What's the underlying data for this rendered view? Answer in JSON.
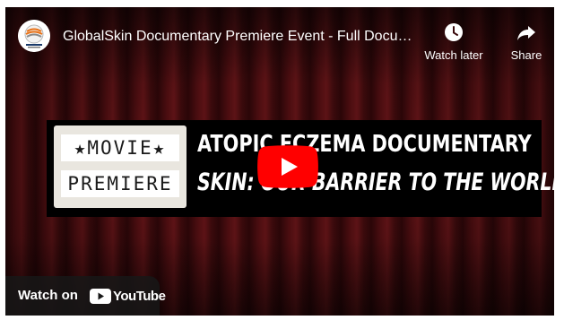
{
  "header": {
    "title": "GlobalSkin Documentary Premiere Event - Full Documentary",
    "watch_later_label": "Watch later",
    "share_label": "Share"
  },
  "banner": {
    "lightbox_line1": "★MOVIE★",
    "lightbox_line2": "PREMIERE",
    "line1": "ATOPIC ECZEMA DOCUMENTARY",
    "line2": "SKIN: OUR BARRIER TO THE WORLD"
  },
  "footer": {
    "watch_on_label": "Watch on",
    "logo_text": "YouTube"
  },
  "colors": {
    "play_red": "#ff0000",
    "curtain": "#4a0d10"
  },
  "icons": {
    "watch_later": "clock-icon",
    "share": "share-arrow-icon",
    "play": "play-icon",
    "youtube": "youtube-logo-icon"
  }
}
